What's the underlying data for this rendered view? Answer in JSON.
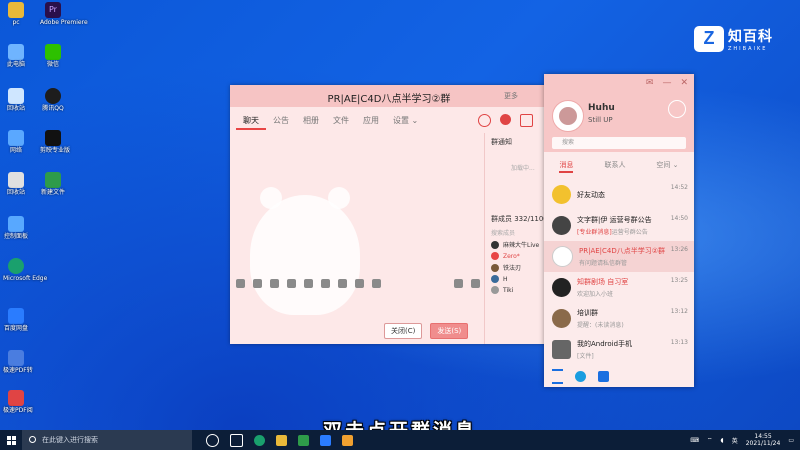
{
  "desktop_icons": [
    {
      "label": "pc",
      "color": "#e9b93a"
    },
    {
      "label": "Adobe Premiere",
      "color": "#2a0f4a"
    },
    {
      "label": "此电脑",
      "color": "#6fb4ff"
    },
    {
      "label": "微信",
      "color": "#2dc100"
    },
    {
      "label": "回收站",
      "color": "#cfe6ff"
    },
    {
      "label": "腾讯QQ",
      "color": "#1d1d1d"
    },
    {
      "label": "网络",
      "color": "#5aa8ff"
    },
    {
      "label": "剪映专业版",
      "color": "#111111"
    },
    {
      "label": "回收站",
      "color": "#e0e0e0"
    },
    {
      "label": "新建文件",
      "color": "#2e9b4a"
    },
    {
      "label": "控制面板",
      "color": "#58a8ff"
    },
    {
      "label": "Microsoft Edge",
      "color": "#1aa06d"
    },
    {
      "label": "百度网盘",
      "color": "#2a7cff"
    },
    {
      "label": "极速PDF转",
      "color": "#4a7de0"
    },
    {
      "label": "极速PDF阅",
      "color": "#e04444"
    }
  ],
  "watermark": {
    "cn": "知百科",
    "en": "ZHIBAIKE"
  },
  "group_window": {
    "title": "PR|AE|C4D八点半学习②群",
    "more": "更多",
    "tabs": [
      "聊天",
      "公告",
      "相册",
      "文件",
      "应用",
      "设置 ⌄"
    ],
    "side_header": "群通知",
    "side_sub": "加载中...",
    "member_header": "群成员 332/1100",
    "member_search": "搜索成员",
    "members": [
      {
        "name": "麻辣大牛Live",
        "color": "#333333"
      },
      {
        "name": "Zero*",
        "color": "#e84545"
      },
      {
        "name": "铁法刃",
        "color": "#7a5a3a"
      },
      {
        "name": "H",
        "color": "#3a6a9a"
      },
      {
        "name": "Tiki",
        "color": "#999999"
      }
    ],
    "close_label": "关闭(C)",
    "send_label": "发送(S)"
  },
  "qq_panel": {
    "name": "Huhu",
    "signature": "Still UP",
    "search_placeholder": "搜索",
    "tabs": [
      "消息",
      "联系人",
      "空间 ⌄"
    ],
    "conversations": [
      {
        "name": "好友动态",
        "message": "",
        "time": "14:52",
        "color": "#f2c12e",
        "highlight": false
      },
      {
        "name": "文字群|伊 运营号群公告",
        "tag": "[专业群消息]",
        "message": "运营号群公告",
        "time": "14:50",
        "color": "#444444",
        "highlight": false
      },
      {
        "name": "PR|AE|C4D八点半学习②群",
        "message": "有问题请私信群管",
        "time": "13:26",
        "color": "#ffffff",
        "highlight": true
      },
      {
        "name": "知群剧场 自习室",
        "message": "欢迎加入小班",
        "time": "13:25",
        "color": "#222222",
        "highlight": false
      },
      {
        "name": "培训群",
        "message": "提醒：(未读消息)",
        "time": "13:12",
        "color": "#8a6a4a",
        "highlight": false
      },
      {
        "name": "我的Android手机",
        "message": "[文件]",
        "time": "13:13",
        "color": "#666666",
        "highlight": false
      }
    ]
  },
  "subtitle": "双击点开群消息",
  "taskbar": {
    "search_placeholder": "在此键入进行搜索",
    "time": "14:55",
    "date": "2021/11/24",
    "ime": "英"
  }
}
